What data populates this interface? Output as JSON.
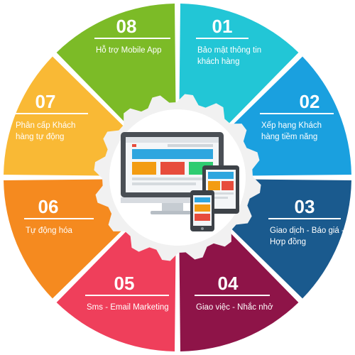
{
  "segments": [
    {
      "number": "01",
      "label_lines": [
        "Bảo mật thông tin",
        "khách hàng"
      ],
      "color": "#22c6d6"
    },
    {
      "number": "02",
      "label_lines": [
        "Xếp hạng Khách",
        "hàng tiềm năng"
      ],
      "color": "#1aa0df"
    },
    {
      "number": "03",
      "label_lines": [
        "Giao dịch - Báo giá -",
        "Hợp đồng"
      ],
      "color": "#1a5a8e"
    },
    {
      "number": "04",
      "label_lines": [
        "Giao việc - Nhắc nhở"
      ],
      "color": "#8e1448"
    },
    {
      "number": "05",
      "label_lines": [
        "Sms - Email Marketing"
      ],
      "color": "#ef3f5b"
    },
    {
      "number": "06",
      "label_lines": [
        "Tự động hóa"
      ],
      "color": "#f58a1f"
    },
    {
      "number": "07",
      "label_lines": [
        "Phân cấp Khách",
        "hàng tự động"
      ],
      "color": "#f9b935"
    },
    {
      "number": "08",
      "label_lines": [
        "Hỗ trợ Mobile App"
      ],
      "color": "#7cbb27"
    }
  ],
  "center": {
    "icon": "devices-icon",
    "gear_color": "#f1f1f1",
    "hub_color": "#ffffff"
  }
}
